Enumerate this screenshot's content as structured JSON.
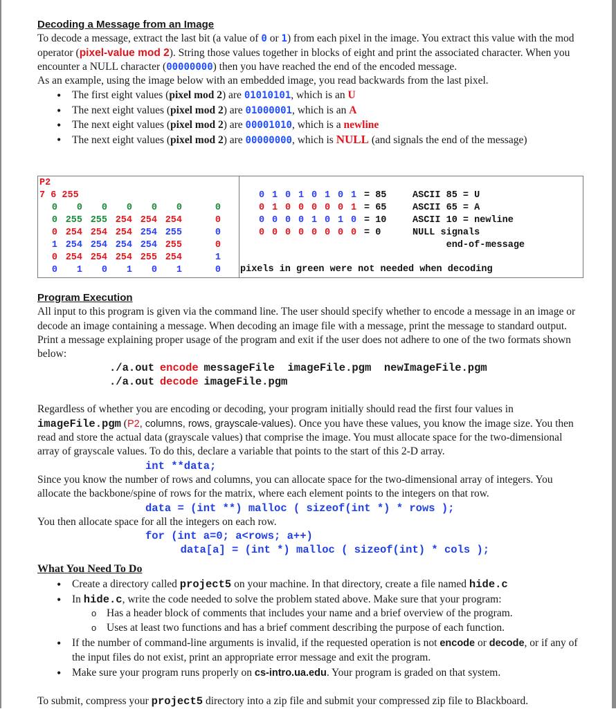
{
  "section1": {
    "heading": "Decoding a Message from an Image",
    "p1": {
      "t1": "To decode a message, extract the last bit (a value of ",
      "zero": "0",
      "t2": " or ",
      "one": "1",
      "t3": ") from each pixel in the image.  You extract this value with the mod operator (",
      "mod": "pixel-value mod 2",
      "t4": ").  String those values together in blocks of eight and print the associated character.  When you encounter a NULL character (",
      "null_bits": "00000000",
      "t5": ") then you have reached the end of the encoded message."
    },
    "p2": "As an example, using the image below with an embedded image, you read backwards from the last pixel.",
    "bullets": [
      {
        "pre": "The first eight values (",
        "bold": "pixel mod 2",
        "mid": ") are ",
        "bits": "01010101",
        "post": ", which is an ",
        "result": "U",
        "tail": ""
      },
      {
        "pre": "The next eight values (",
        "bold": "pixel mod 2",
        "mid": ") are ",
        "bits": "01000001",
        "post": ", which is an ",
        "result": "A",
        "tail": ""
      },
      {
        "pre": "The next eight values (",
        "bold": "pixel mod 2",
        "mid": ") are ",
        "bits": "00001010",
        "post": ", which is a ",
        "result": "newline",
        "tail": ""
      },
      {
        "pre": "The next eight values (",
        "bold": "pixel mod 2",
        "mid": ") are ",
        "bits": "00000000",
        "post": ", which is ",
        "result": "NULL",
        "tail": " (and signals the end of the message)"
      }
    ]
  },
  "example": {
    "header_line1": "P2",
    "header_line2": "7 6 255",
    "pixel_rows": [
      [
        {
          "v": "0",
          "c": "g"
        },
        {
          "v": "0",
          "c": "g"
        },
        {
          "v": "0",
          "c": "g"
        },
        {
          "v": "0",
          "c": "g"
        },
        {
          "v": "0",
          "c": "g"
        },
        {
          "v": "0",
          "c": "g"
        },
        {
          "v": "0",
          "c": "g"
        }
      ],
      [
        {
          "v": "0",
          "c": "g"
        },
        {
          "v": "255",
          "c": "g"
        },
        {
          "v": "255",
          "c": "g"
        },
        {
          "v": "254",
          "c": "r"
        },
        {
          "v": "254",
          "c": "r"
        },
        {
          "v": "254",
          "c": "r"
        },
        {
          "v": "0",
          "c": "r"
        }
      ],
      [
        {
          "v": "0",
          "c": "r"
        },
        {
          "v": "254",
          "c": "r"
        },
        {
          "v": "254",
          "c": "r"
        },
        {
          "v": "254",
          "c": "r"
        },
        {
          "v": "254",
          "c": "bl"
        },
        {
          "v": "255",
          "c": "bl"
        },
        {
          "v": "0",
          "c": "bl"
        }
      ],
      [
        {
          "v": "1",
          "c": "bl"
        },
        {
          "v": "254",
          "c": "bl"
        },
        {
          "v": "254",
          "c": "bl"
        },
        {
          "v": "254",
          "c": "bl"
        },
        {
          "v": "254",
          "c": "bl"
        },
        {
          "v": "255",
          "c": "r"
        },
        {
          "v": "0",
          "c": "r"
        }
      ],
      [
        {
          "v": "0",
          "c": "r"
        },
        {
          "v": "254",
          "c": "r"
        },
        {
          "v": "254",
          "c": "r"
        },
        {
          "v": "254",
          "c": "r"
        },
        {
          "v": "255",
          "c": "r"
        },
        {
          "v": "254",
          "c": "r"
        },
        {
          "v": "1",
          "c": "bl"
        }
      ],
      [
        {
          "v": "0",
          "c": "bl"
        },
        {
          "v": "1",
          "c": "bl"
        },
        {
          "v": "0",
          "c": "bl"
        },
        {
          "v": "1",
          "c": "bl"
        },
        {
          "v": "0",
          "c": "bl"
        },
        {
          "v": "1",
          "c": "bl"
        },
        {
          "v": "0",
          "c": "bl"
        }
      ]
    ],
    "bit_rows": [
      {
        "bits": [
          {
            "v": "0",
            "c": "bl"
          },
          {
            "v": "1",
            "c": "bl"
          },
          {
            "v": "0",
            "c": "bl"
          },
          {
            "v": "1",
            "c": "bl"
          },
          {
            "v": "0",
            "c": "bl"
          },
          {
            "v": "1",
            "c": "bl"
          },
          {
            "v": "0",
            "c": "bl"
          },
          {
            "v": "1",
            "c": "bl"
          }
        ],
        "value": "= 85"
      },
      {
        "bits": [
          {
            "v": "0",
            "c": "r"
          },
          {
            "v": "1",
            "c": "r"
          },
          {
            "v": "0",
            "c": "r"
          },
          {
            "v": "0",
            "c": "r"
          },
          {
            "v": "0",
            "c": "r"
          },
          {
            "v": "0",
            "c": "r"
          },
          {
            "v": "0",
            "c": "r"
          },
          {
            "v": "1",
            "c": "r"
          }
        ],
        "value": "= 65"
      },
      {
        "bits": [
          {
            "v": "0",
            "c": "bl"
          },
          {
            "v": "0",
            "c": "bl"
          },
          {
            "v": "0",
            "c": "bl"
          },
          {
            "v": "0",
            "c": "bl"
          },
          {
            "v": "1",
            "c": "bl"
          },
          {
            "v": "0",
            "c": "bl"
          },
          {
            "v": "1",
            "c": "bl"
          },
          {
            "v": "0",
            "c": "bl"
          }
        ],
        "value": "= 10"
      },
      {
        "bits": [
          {
            "v": "0",
            "c": "r"
          },
          {
            "v": "0",
            "c": "r"
          },
          {
            "v": "0",
            "c": "r"
          },
          {
            "v": "0",
            "c": "r"
          },
          {
            "v": "0",
            "c": "r"
          },
          {
            "v": "0",
            "c": "r"
          },
          {
            "v": "0",
            "c": "r"
          },
          {
            "v": "0",
            "c": "r"
          }
        ],
        "value": "= 0"
      }
    ],
    "ascii_lines": [
      "ASCII 85 = U",
      "ASCII 65 = A",
      "ASCII 10 = newline",
      "NULL signals",
      "      end-of-message"
    ],
    "footnote": "pixels in green were not needed when decoding"
  },
  "section2": {
    "heading": "Program Execution",
    "p1": "All input to this program is given via the command line.  The user should specify whether to encode a message in an image or decode an image containing a message.  When decoding an image file with a message, print the message to standard output.  Print a message explaining proper usage of the program and exit if the user does not adhere to one of the two formats shown below:",
    "cmd_encode": {
      "prog": "./a.out",
      "op": "encode",
      "args": "messageFile  imageFile.pgm  newImageFile.pgm"
    },
    "cmd_decode": {
      "prog": "./a.out",
      "op": "decode",
      "args": "imageFile.pgm"
    },
    "p2": {
      "t1": "Regardless of whether you are encoding or decoding, your program initially should read the first four values in ",
      "file": "imageFile.pgm",
      "t2": " (",
      "p2tag": "P2",
      "t3": ", columns, rows, grayscale-values)",
      "t4": ".  Once you have these values, you know the image size. You then read and store the actual data (grayscale values) that comprise the image.  You must allocate space for the two-dimensional array of grayscale values.  To do this, declare a variable that points to the start of this 2-D array."
    },
    "code1": "int **data;",
    "p3": "Since you know the number of rows and columns, you can allocate space for the two-dimensional array of integers. You allocate the backbone/spine of rows for the matrix, where each element points to the integers on that row.",
    "code2": "data = (int **) malloc ( sizeof(int *) * rows );",
    "p4": "You then allocate space for all the integers on each row.",
    "code3": "for (int a=0; a<rows; a++)",
    "code4": "  data[a] = (int *) malloc ( sizeof(int) * cols );"
  },
  "section3": {
    "heading": "What You Need To Do",
    "b1": {
      "t1": "Create a directory called ",
      "dir": "project5",
      "t2": " on your machine.  In that directory, create a file named ",
      "file": "hide.c"
    },
    "b2": {
      "t1": "In ",
      "file": "hide.c",
      "t2": ", write the code needed to solve the problem stated above.  Make sure that your program:"
    },
    "sub": [
      "Has a header block of comments that includes your name and a brief overview of the program.",
      "Uses at least two functions and has a brief comment describing the purpose of each function."
    ],
    "b3": {
      "t1": "If the number of command-line arguments is invalid, if the requested operation is not ",
      "op1": "encode",
      "t2": " or ",
      "op2": "decode",
      "t3": ", or if any of the input files do not exist, print an appropriate error message and exit the program."
    },
    "b4": {
      "t1": "Make sure your program runs properly on ",
      "host": "cs-intro.ua.edu",
      "t2": ".  Your program is graded on that system."
    },
    "submit": {
      "t1": "To submit, compress your ",
      "dir": "project5",
      "t2": " directory into a zip file and submit your compressed zip file to Blackboard."
    }
  }
}
